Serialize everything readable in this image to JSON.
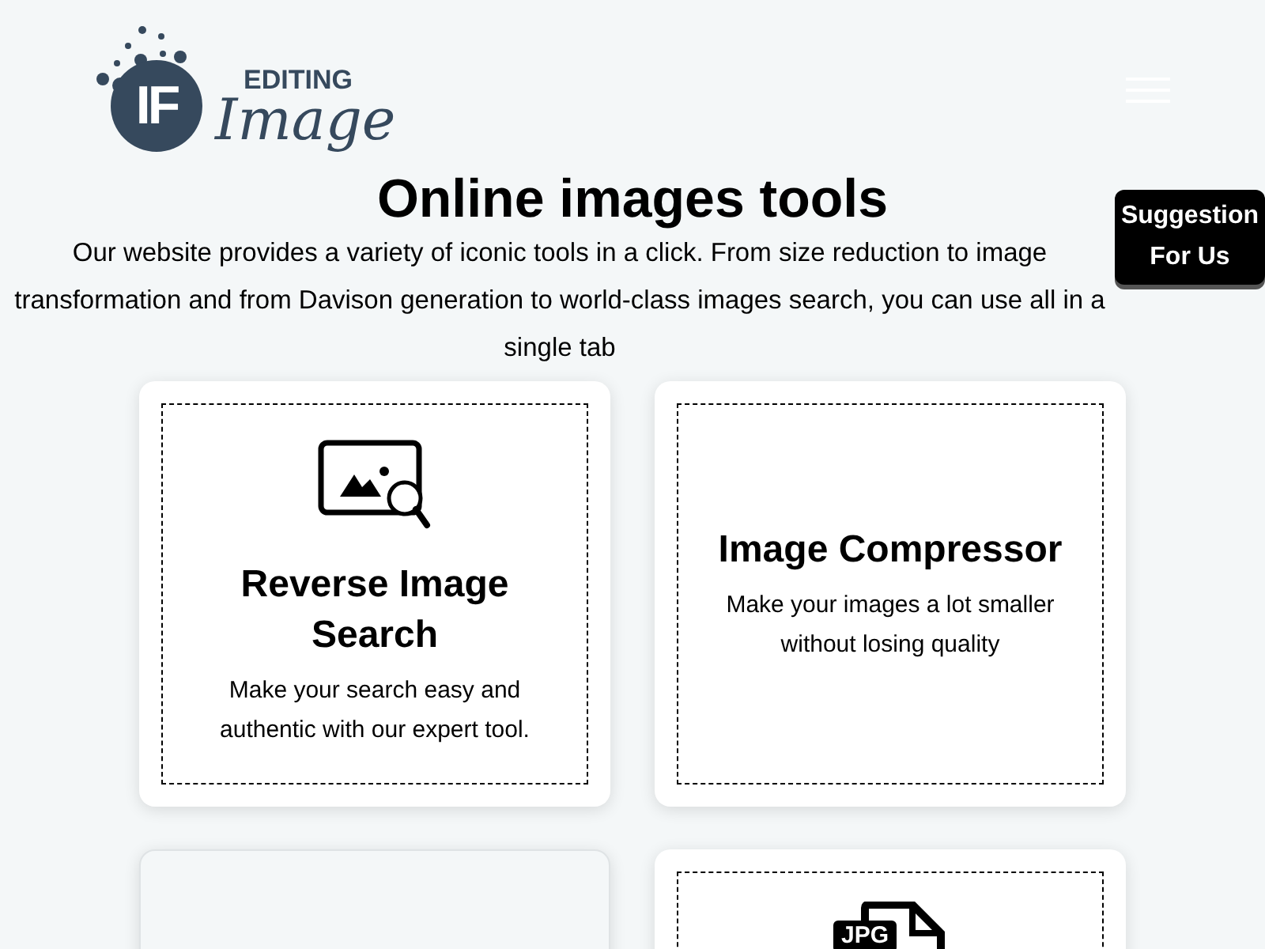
{
  "logo": {
    "monogram": "IF",
    "word_top": "EDITING",
    "word_script": "Image"
  },
  "menu_toggle": {
    "expanded": false
  },
  "heading": "Online images tools",
  "intro": "Our website provides a variety of iconic tools in a click. From size reduction to image transformation and from Davison generation to world-class images search, you can use all in a single tab",
  "suggestion_button": "Suggestion For Us",
  "cards": [
    {
      "kind": "search",
      "title": "Reverse Image Search",
      "description": "Make your search easy and authentic with our expert tool."
    },
    {
      "kind": "plain",
      "title": "Image Compressor",
      "description": "Make your images a lot smaller without losing quality"
    },
    {
      "kind": "empty"
    },
    {
      "kind": "jpg",
      "icon_label": "JPG"
    }
  ]
}
